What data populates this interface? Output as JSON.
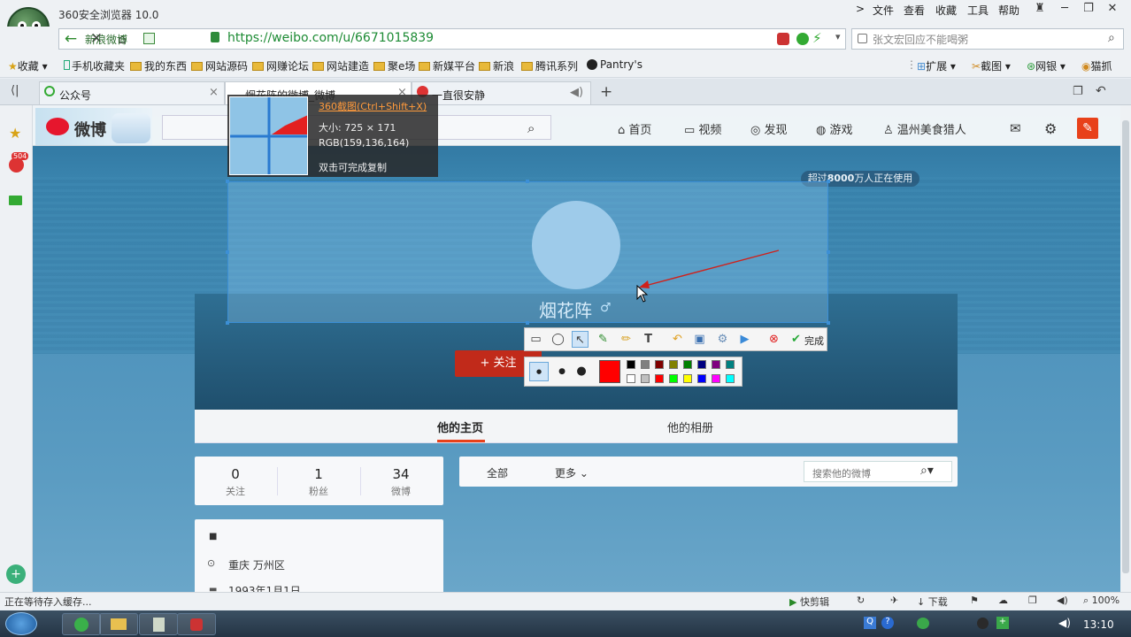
{
  "browser": {
    "app_title": "360安全浏览器 10.0",
    "menu": [
      "文件",
      "查看",
      "收藏",
      "工具",
      "帮助"
    ],
    "site_badge": "新浪微博",
    "url": "https://weibo.com/u/6671015839",
    "search_placeholder": "张文宏回应不能喝粥",
    "bookmarks": [
      "收藏",
      "手机收藏夹",
      "我的东西",
      "网站源码",
      "网赚论坛",
      "网站建造",
      "聚e场",
      "新媒平台",
      "新浪",
      "腾讯系列",
      "Pantry's"
    ],
    "right_tools": [
      "扩展",
      "截图",
      "网银",
      "猫抓"
    ],
    "tabs": [
      "公众号",
      "烟花阵的微博_微博",
      "一直很安静"
    ],
    "sidebar_badge": "504",
    "status_text": "正在等待存入缓存...",
    "status_right": [
      "快剪辑",
      "下载",
      "100%"
    ]
  },
  "weibo": {
    "logo": "微博",
    "nav": [
      "首页",
      "视频",
      "发现",
      "游戏",
      "温州美食猎人"
    ],
    "users_badge_prefix": "超过",
    "users_badge_count": "8000",
    "users_badge_suffix": "万人正在使用",
    "profile_name": "烟花阵",
    "gender_symbol": "♂",
    "follow_label": "+ 关注",
    "tab_home": "他的主页",
    "tab_album": "他的相册",
    "stats": [
      {
        "num": "0",
        "label": "关注"
      },
      {
        "num": "1",
        "label": "粉丝"
      },
      {
        "num": "34",
        "label": "微博"
      }
    ],
    "feed_all": "全部",
    "feed_more": "更多",
    "feed_search": "搜索他的微博",
    "location": "重庆 万州区",
    "birthday": "1993年1月1日"
  },
  "capture_tool": {
    "title": "360截图(Ctrl+Shift+X)",
    "size": "大小: 725 × 171",
    "rgb": "RGB(159,136,164)",
    "hint": "双击可完成复制",
    "done_label": "完成",
    "palette_colors": [
      "#000000",
      "#808080",
      "#800000",
      "#808000",
      "#008000",
      "#000080",
      "#800080",
      "#008080",
      "#ffffff",
      "#c0c0c0",
      "#ff0000",
      "#00ff00",
      "#ffff00",
      "#0000ff",
      "#ff00ff",
      "#00ffff"
    ],
    "active_color": "#ff0000"
  },
  "taskbar": {
    "clock": "13:10"
  }
}
